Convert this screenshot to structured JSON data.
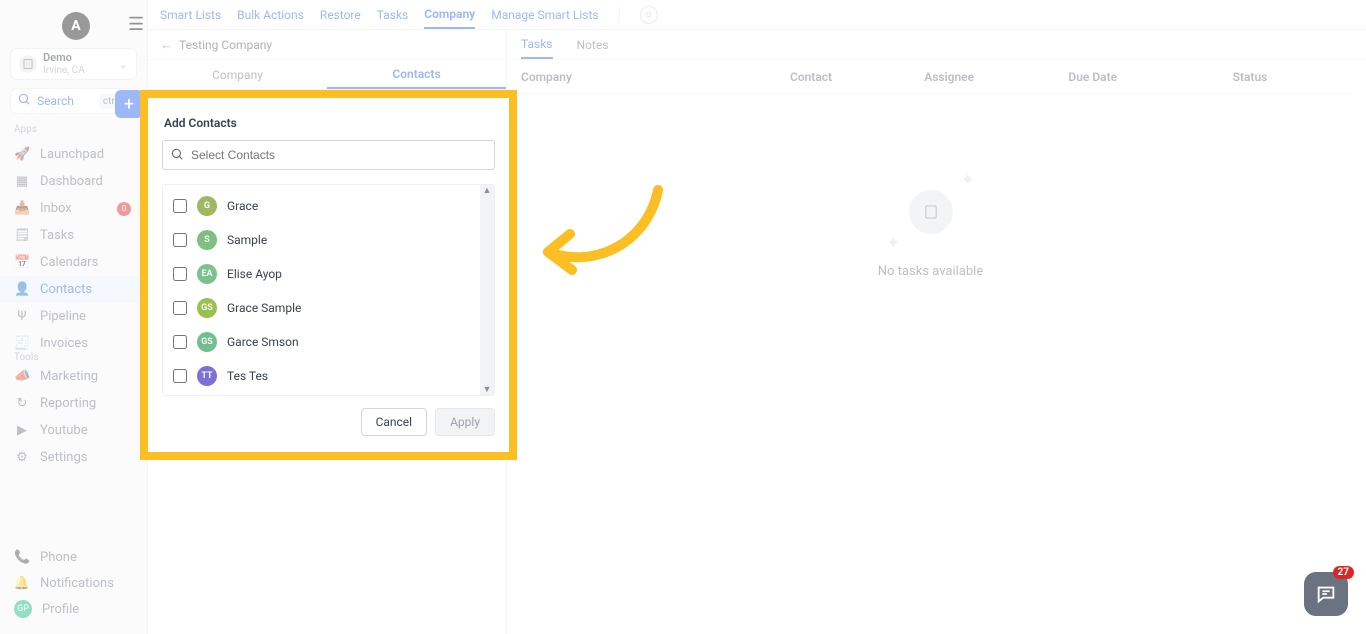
{
  "account": {
    "name": "Demo",
    "location": "Irvine, CA",
    "avatar_letter": "A"
  },
  "search": {
    "label": "Search",
    "shortcut": "ctrl K"
  },
  "sections": {
    "apps": "Apps",
    "tools": "Tools"
  },
  "nav": {
    "launchpad": "Launchpad",
    "dashboard": "Dashboard",
    "inbox": "Inbox",
    "inbox_badge": "0",
    "tasks": "Tasks",
    "calendars": "Calendars",
    "contacts": "Contacts",
    "pipeline": "Pipeline",
    "invoices": "Invoices",
    "marketing": "Marketing",
    "reporting": "Reporting",
    "youtube": "Youtube",
    "settings": "Settings",
    "phone": "Phone",
    "notifications": "Notifications",
    "profile": "Profile",
    "profile_initials": "GP"
  },
  "toptabs": {
    "smart_lists": "Smart Lists",
    "bulk_actions": "Bulk Actions",
    "restore": "Restore",
    "tasks": "Tasks",
    "company": "Company",
    "manage": "Manage Smart Lists"
  },
  "breadcrumb": {
    "title": "Testing Company"
  },
  "subtabs": {
    "company": "Company",
    "contacts": "Contacts"
  },
  "rightpanel": {
    "tab_tasks": "Tasks",
    "tab_notes": "Notes",
    "cols": {
      "company": "Company",
      "contact": "Contact",
      "assignee": "Assignee",
      "duedate": "Due Date",
      "status": "Status"
    },
    "empty_text": "No tasks available"
  },
  "modal": {
    "title": "Add Contacts",
    "search_placeholder": "Select Contacts",
    "cancel": "Cancel",
    "apply": "Apply",
    "contacts": [
      {
        "initials": "G",
        "name": "Grace",
        "color": "#a3b763"
      },
      {
        "initials": "S",
        "name": "Sample",
        "color": "#7fbf7f"
      },
      {
        "initials": "EA",
        "name": "Elise Ayop",
        "color": "#7cc08e"
      },
      {
        "initials": "GS",
        "name": "Grace Sample",
        "color": "#9ac04f"
      },
      {
        "initials": "GS",
        "name": "Garce Smson",
        "color": "#6fc08e"
      },
      {
        "initials": "TT",
        "name": "Tes Tes",
        "color": "#7c6fd6"
      }
    ]
  },
  "chat_badge": "27"
}
